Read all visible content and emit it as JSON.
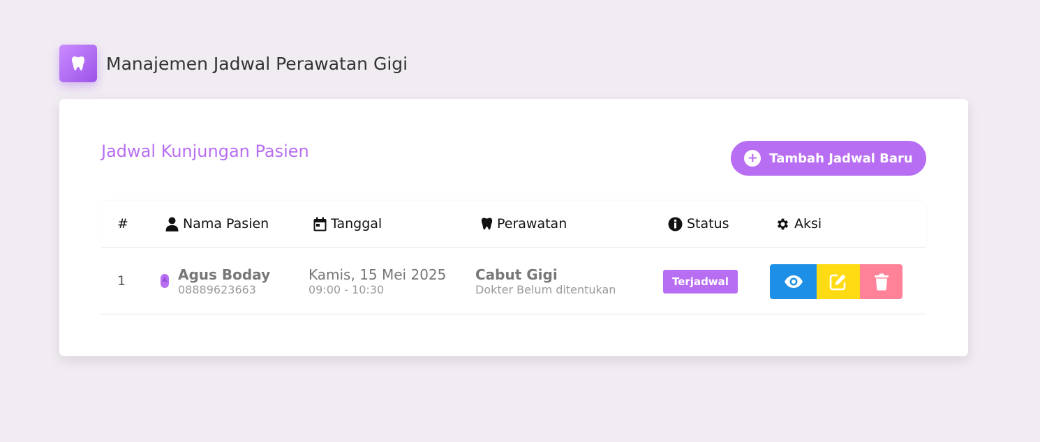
{
  "header": {
    "title": "Manajemen Jadwal Perawatan Gigi",
    "logo_icon": "tooth-icon"
  },
  "card": {
    "title": "Jadwal Kunjungan Pasien",
    "add_button_label": "Tambah Jadwal Baru",
    "add_button_icon": "plus-circle-icon"
  },
  "table": {
    "columns": [
      {
        "label": "#",
        "icon": ""
      },
      {
        "label": "Nama Pasien",
        "icon": "user-icon"
      },
      {
        "label": "Tanggal",
        "icon": "calendar-icon"
      },
      {
        "label": "Perawatan",
        "icon": "tooth-icon"
      },
      {
        "label": "Status",
        "icon": "info-circle-icon"
      },
      {
        "label": "Aksi",
        "icon": "gear-icon"
      }
    ],
    "rows": [
      {
        "number": "1",
        "avatar_letter": "A",
        "patient_name": "Agus Boday",
        "patient_phone": "08889623663",
        "date": "Kamis, 15 Mei 2025",
        "time": "09:00 - 10:30",
        "treatment": "Cabut Gigi",
        "doctor": "Dokter Belum ditentukan",
        "status": "Terjadwal",
        "actions": [
          "eye-icon",
          "edit-icon",
          "trash-icon"
        ]
      }
    ]
  },
  "colors": {
    "accent": "#b86ef2",
    "view": "#1e8fe6",
    "edit": "#ffdb14",
    "delete": "#ff8298",
    "background": "#f1ecf2"
  }
}
